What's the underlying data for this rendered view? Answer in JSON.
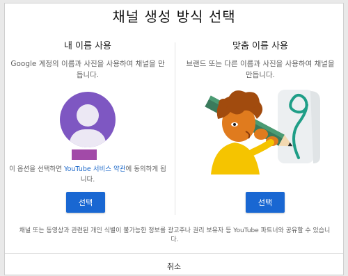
{
  "dialog": {
    "title": "채널 생성 방식 선택",
    "left": {
      "title": "내 이름 사용",
      "description": "Google 계정의 이름과 사진을 사용하여 채널을 만듭니다.",
      "terms_prefix": "이 옵션을 선택하면",
      "terms_link": "YouTube 서비스 약관",
      "terms_suffix": "에 동의하게 됩니다.",
      "button_label": "선택",
      "avatar_color": "#7e57c2",
      "swatch_color": "#a24aa8"
    },
    "right": {
      "title": "맞춤 이름 사용",
      "description": "브랜드 또는 다른 이름과 사진을 사용하여 채널을 만듭니다.",
      "button_label": "선택"
    },
    "footer_note": "채널 또는 동영상과 관련된 개인 식별이 불가능한 정보를 광고주나 권리 보유자 등 YouTube 파트너와 공유할 수 있습니다.",
    "cancel_label": "취소",
    "accent_color": "#1967d2"
  }
}
